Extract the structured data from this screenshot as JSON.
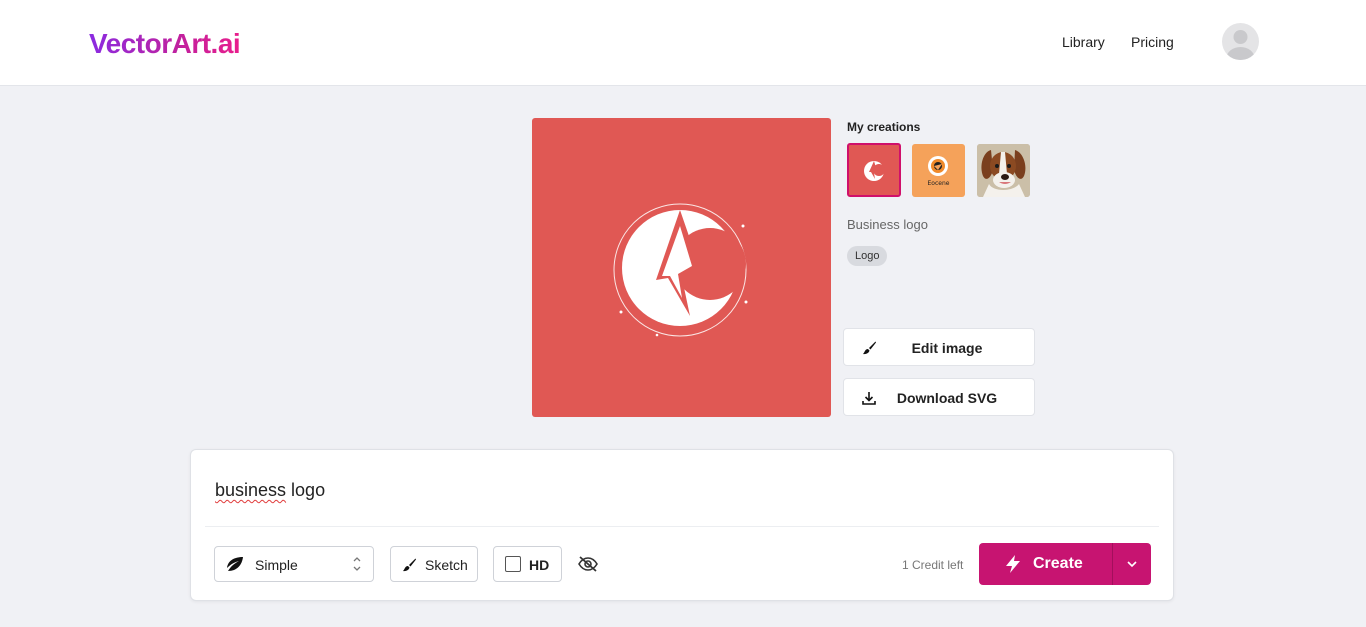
{
  "header": {
    "logo": "VectorArt.ai",
    "nav": [
      {
        "label": "Library"
      },
      {
        "label": "Pricing"
      }
    ],
    "avatar_icon": "user-avatar-icon"
  },
  "preview": {
    "background": "#e05854"
  },
  "creations": {
    "title": "My creations",
    "thumbnails": [
      {
        "name": "business-logo",
        "color": "#e05854",
        "selected": true
      },
      {
        "name": "orange-logo",
        "color": "#f5a25a",
        "text": "Eocene"
      },
      {
        "name": "dog-portrait",
        "color": "#cbbfa8"
      }
    ],
    "selected_label": "Business logo",
    "tag": "Logo"
  },
  "actions": {
    "edit_label": "Edit image",
    "download_label": "Download SVG"
  },
  "prompt": {
    "text_misspelled": "business",
    "text_rest": " logo"
  },
  "controls": {
    "style_label": "Simple",
    "sketch_label": "Sketch",
    "hd_label": "HD",
    "hd_checked": false,
    "credits": "1 Credit left",
    "create_label": "Create"
  },
  "colors": {
    "accent": "#c71471",
    "logo_gradient_start": "#8a2be2",
    "logo_gradient_end": "#e91e8c"
  }
}
